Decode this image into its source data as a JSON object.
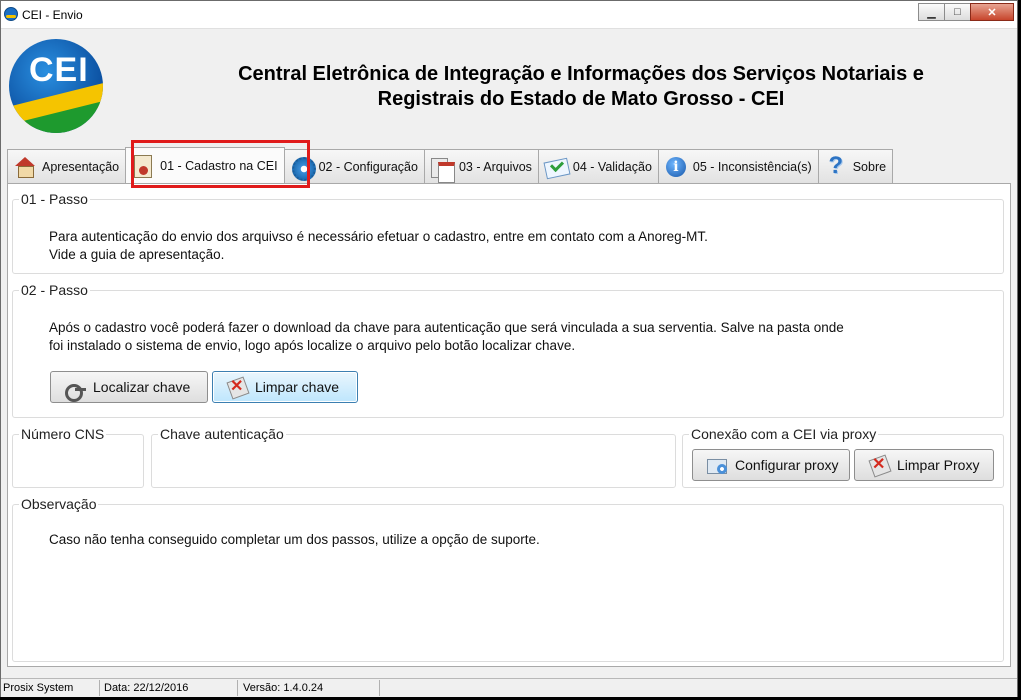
{
  "window": {
    "title": "CEI - Envio",
    "minimize_glyph": "▁",
    "maximize_glyph": "□",
    "close_glyph": "✕"
  },
  "header": {
    "logo_text": "CEI",
    "title_line1": "Central Eletrônica de Integração e Informações dos Serviços Notariais e",
    "title_line2": "Registrais do Estado de Mato Grosso - CEI"
  },
  "tabs": [
    {
      "label": "Apresentação",
      "icon": "house-icon"
    },
    {
      "label": "01 - Cadastro na CEI",
      "icon": "document-seal-icon",
      "active": true
    },
    {
      "label": "02 - Configuração",
      "icon": "gear-icon"
    },
    {
      "label": "03 - Arquivos",
      "icon": "files-icon"
    },
    {
      "label": "04 - Validação",
      "icon": "validation-icon"
    },
    {
      "label": "05 - Inconsistência(s)",
      "icon": "info-icon"
    },
    {
      "label": "Sobre",
      "icon": "help-icon"
    }
  ],
  "step1": {
    "legend": "01 - Passo",
    "line1": "Para autenticação do envio dos arquivso é necessário efetuar o cadastro, entre em contato com a Anoreg-MT.",
    "line2": "Vide a guia de apresentação."
  },
  "step2": {
    "legend": "02 - Passo",
    "line1": "Após o cadastro você poderá fazer o download da chave para autenticação que será vinculada a sua serventia.  Salve na pasta onde",
    "line2": "foi instalado o sistema de envio,  logo após localize o arquivo pelo botão localizar chave.",
    "locate_button": "Localizar chave",
    "clear_button": "Limpar chave"
  },
  "cns": {
    "legend": "Número CNS",
    "value": ""
  },
  "auth_key": {
    "legend": "Chave autenticação",
    "value": ""
  },
  "proxy": {
    "legend": "Conexão com a CEI via proxy",
    "configure_button": "Configurar proxy",
    "clear_button": "Limpar Proxy"
  },
  "notes": {
    "legend": "Observação",
    "text": "Caso não tenha conseguido completar um dos passos, utilize a opção de suporte."
  },
  "status": {
    "company": "Prosix System",
    "date": "Data: 22/12/2016",
    "version": "Versão: 1.4.0.24"
  },
  "colors": {
    "highlight": "#e01b1b",
    "focus_button": "#bee6fd"
  }
}
